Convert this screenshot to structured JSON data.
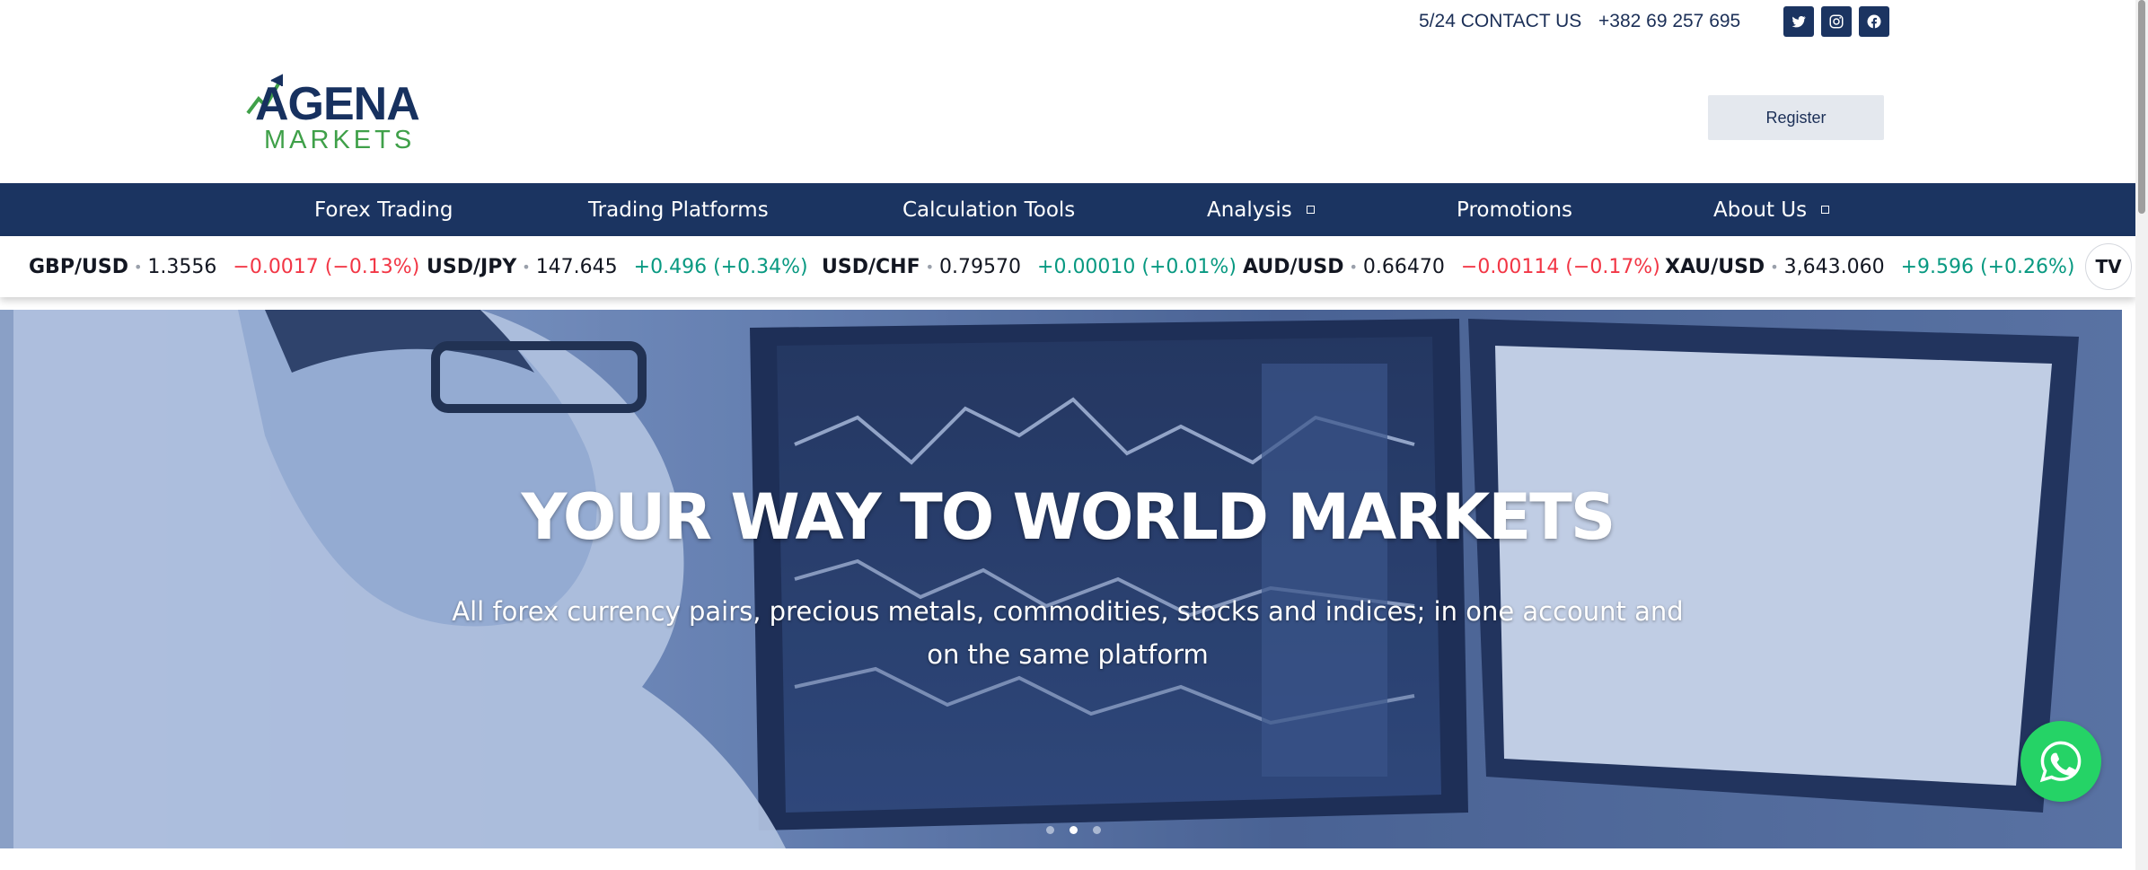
{
  "topbar": {
    "contact": "5/24 CONTACT US",
    "phone": "+382 69 257 695",
    "socials": [
      "twitter-icon",
      "instagram-icon",
      "facebook-icon"
    ]
  },
  "logo": {
    "top": "AGENA",
    "bottom": "MARKETS"
  },
  "header": {
    "register_label": "Register"
  },
  "nav": {
    "items": [
      {
        "label": "Forex Trading"
      },
      {
        "label": "Trading Platforms"
      },
      {
        "label": "Calculation Tools"
      },
      {
        "label": "Analysis"
      },
      {
        "label": "Promotions"
      },
      {
        "label": "About Us"
      }
    ]
  },
  "ticker": {
    "items": [
      {
        "symbol": "GBP/USD",
        "price": "1.3556",
        "change": "−0.0017 (−0.13%)",
        "direction": "down"
      },
      {
        "symbol": "USD/JPY",
        "price": "147.645",
        "change": "+0.496 (+0.34%)",
        "direction": "up"
      },
      {
        "symbol": "USD/CHF",
        "price": "0.79570",
        "change": "+0.00010 (+0.01%)",
        "direction": "up"
      },
      {
        "symbol": "AUD/USD",
        "price": "0.66470",
        "change": "−0.00114 (−0.17%)",
        "direction": "down"
      },
      {
        "symbol": "XAU/USD",
        "price": "3,643.060",
        "change": "+9.596 (+0.26%)",
        "direction": "up"
      }
    ],
    "badge": "TV"
  },
  "hero": {
    "title": "YOUR WAY TO WORLD MARKETS",
    "subtitle": "All forex currency pairs, precious metals, commodities, stocks and indices; in one account and on the same platform",
    "active_slide": 2,
    "slide_count": 3
  },
  "colors": {
    "navy": "#1b3461",
    "green": "#3fa049",
    "negative": "#f23645",
    "positive": "#089981",
    "whatsapp": "#25d366"
  }
}
